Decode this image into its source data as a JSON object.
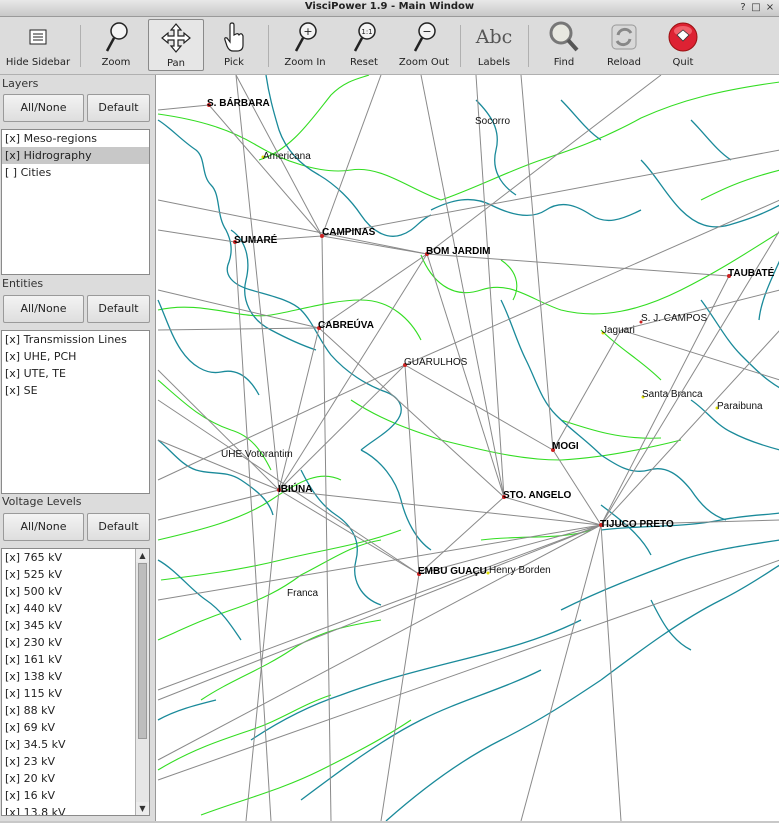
{
  "window": {
    "title": "VisciPower 1.9 - Main Window",
    "help_glyph": "?",
    "max_glyph": "□",
    "close_glyph": "×"
  },
  "toolbar": {
    "buttons": [
      {
        "id": "hide-sidebar",
        "label": "Hide Sidebar",
        "icon": "sidebar-icon"
      },
      {
        "id": "zoom",
        "label": "Zoom",
        "icon": "magnifier-icon"
      },
      {
        "id": "pan",
        "label": "Pan",
        "icon": "pan-arrows-icon",
        "active": true
      },
      {
        "id": "pick",
        "label": "Pick",
        "icon": "hand-pointer-icon"
      },
      {
        "id": "zoom-in",
        "label": "Zoom In",
        "icon": "zoom-in-icon",
        "glyph": "+"
      },
      {
        "id": "reset",
        "label": "Reset",
        "icon": "zoom-reset-icon",
        "glyph": "1:1"
      },
      {
        "id": "zoom-out",
        "label": "Zoom Out",
        "icon": "zoom-out-icon",
        "glyph": "−"
      },
      {
        "id": "labels",
        "label": "Labels",
        "icon": "abc-labels-icon",
        "glyph": "Abc"
      },
      {
        "id": "find",
        "label": "Find",
        "icon": "find-magnifier-icon"
      },
      {
        "id": "reload",
        "label": "Reload",
        "icon": "reload-icon"
      },
      {
        "id": "quit",
        "label": "Quit",
        "icon": "quit-icon"
      }
    ]
  },
  "sidebar": {
    "layers": {
      "title": "Layers",
      "all_none": "All/None",
      "default": "Default",
      "items": [
        "[x] Meso-regions",
        "[x] Hidrography",
        "[ ] Cities"
      ]
    },
    "entities": {
      "title": "Entities",
      "all_none": "All/None",
      "default": "Default",
      "items": [
        "[x] Transmission Lines",
        "[x] UHE, PCH",
        "[x] UTE, TE",
        "[x] SE"
      ]
    },
    "voltage": {
      "title": "Voltage Levels",
      "all_none": "All/None",
      "default": "Default",
      "items": [
        "[x] 765 kV",
        "[x] 525 kV",
        "[x] 500 kV",
        "[x] 440 kV",
        "[x] 345 kV",
        "[x] 230 kV",
        "[x] 161 kV",
        "[x] 138 kV",
        "[x] 115 kV",
        "[x] 88 kV",
        "[x] 69 kV",
        "[x] 34.5 kV",
        "[x] 23 kV",
        "[x] 20 kV",
        "[x] 16 kV",
        "[x] 13.8 kV"
      ],
      "scroll_up_glyph": "▲",
      "scroll_down_glyph": "▼"
    }
  },
  "map": {
    "colors": {
      "lines": "#8a8a8a",
      "rivers": "#1a8a9a",
      "meso": "#33dd22",
      "substation": "#cc2222",
      "plant": "#dddd00"
    },
    "substations": [
      {
        "name": "S. BÁRBARA"
      },
      {
        "name": "SUMARÉ"
      },
      {
        "name": "CAMPINAS"
      },
      {
        "name": "BOM JARDIM"
      },
      {
        "name": "TAUBATÉ"
      },
      {
        "name": "CABREÚVA"
      },
      {
        "name": "MOGI"
      },
      {
        "name": "IBIÚNA"
      },
      {
        "name": "STO. ANGELO"
      },
      {
        "name": "TIJUCO PRETO"
      },
      {
        "name": "EMBU GUAÇU"
      }
    ],
    "labels": [
      {
        "name": "Socorro"
      },
      {
        "name": "Americana"
      },
      {
        "name": "GUARULHOS"
      },
      {
        "name": "S. J. CAMPOS"
      },
      {
        "name": "Jaguari"
      },
      {
        "name": "Santa Branca"
      },
      {
        "name": "Paraibuna"
      },
      {
        "name": "UHE Votorantim"
      },
      {
        "name": "Henry Borden"
      },
      {
        "name": "Franca"
      }
    ]
  }
}
